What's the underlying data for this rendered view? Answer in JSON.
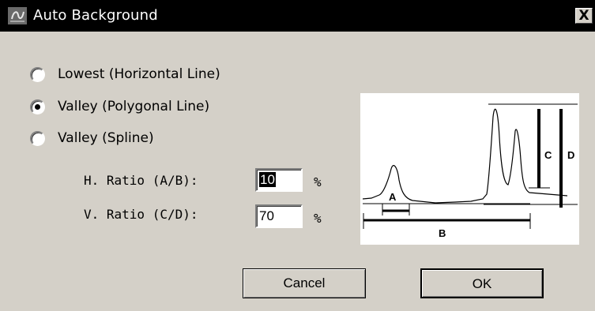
{
  "dialog": {
    "title": "Auto Background",
    "close_label": "X"
  },
  "options": [
    {
      "label": "Lowest (Horizontal Line)",
      "checked": false
    },
    {
      "label": "Valley (Polygonal Line)",
      "checked": true
    },
    {
      "label": "Valley (Spline)",
      "checked": false
    }
  ],
  "h_ratio": {
    "label": "H. Ratio (A/B):",
    "value": "10",
    "unit": "%"
  },
  "v_ratio": {
    "label": "V. Ratio (C/D):",
    "value": "70",
    "unit": "%"
  },
  "diagram_labels": {
    "a": "A",
    "b": "B",
    "c": "C",
    "d": "D"
  },
  "buttons": {
    "cancel": "Cancel",
    "ok": "OK"
  }
}
